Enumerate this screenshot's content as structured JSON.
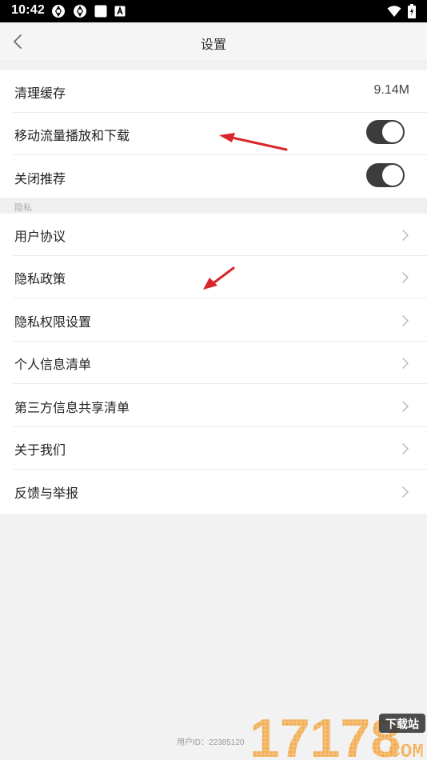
{
  "status_bar": {
    "time": "10:42",
    "left_icons": [
      "loop-icon",
      "loop-icon",
      "square-icon",
      "font-badge-icon"
    ],
    "right_icons": [
      "wifi-icon",
      "battery-charging-icon"
    ]
  },
  "header": {
    "title": "设置",
    "back_icon": "chevron-left-icon"
  },
  "general": {
    "rows": [
      {
        "label": "清理缓存",
        "value": "9.14M"
      },
      {
        "label": "移动流量播放和下载",
        "toggle_on": true
      },
      {
        "label": "关闭推荐",
        "toggle_on": true
      }
    ]
  },
  "privacy": {
    "section_label": "隐私",
    "rows": [
      {
        "label": "用户协议"
      },
      {
        "label": "隐私政策"
      },
      {
        "label": "隐私权限设置"
      },
      {
        "label": "个人信息清单"
      },
      {
        "label": "第三方信息共享清单"
      },
      {
        "label": "关于我们"
      },
      {
        "label": "反馈与举报"
      }
    ]
  },
  "footer": {
    "user_id": "用户ID：22385120"
  },
  "watermark": {
    "number": "17178",
    "badge": "下载站",
    "domain": ".COM"
  },
  "colors": {
    "accent_toggle": "#3c3c3c",
    "annotation_arrow": "#d9262a",
    "watermark_orange": "#f2a23a"
  }
}
